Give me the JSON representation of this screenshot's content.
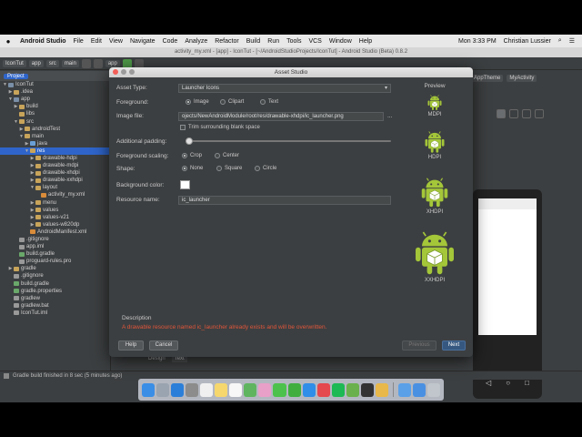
{
  "menubar": {
    "apple": "",
    "app_name": "Android Studio",
    "items": [
      "File",
      "Edit",
      "View",
      "Navigate",
      "Code",
      "Analyze",
      "Refactor",
      "Build",
      "Run",
      "Tools",
      "VCS",
      "Window",
      "Help"
    ],
    "clock": "Mon 3:33 PM",
    "user": "Christian Lussier"
  },
  "ide": {
    "window_title": "activity_my.xml - [app] - IconTut - [~/AndroidStudioProjects/IconTut] - Android Studio (Beta) 0.8.2",
    "breadcrumbs": [
      "IconTut",
      "app",
      "src",
      "main"
    ],
    "run_config": "app",
    "editor_chips": [
      "AppTheme",
      "MyActivity"
    ],
    "bottom_tabs": [
      "Design",
      "Text"
    ],
    "status_text": "Gradle build finished in 8 sec (5 minutes ago)"
  },
  "project": {
    "panel_tab": "Project",
    "tree": [
      {
        "label": "IconTut",
        "depth": 0,
        "twisty": "▼",
        "color": "#7a8fa8"
      },
      {
        "label": ".idea",
        "depth": 1,
        "twisty": "▶",
        "color": "#c8a45a"
      },
      {
        "label": "app",
        "depth": 1,
        "twisty": "▼",
        "color": "#7a8fa8"
      },
      {
        "label": "build",
        "depth": 2,
        "twisty": "▶",
        "color": "#c8a45a"
      },
      {
        "label": "libs",
        "depth": 2,
        "twisty": "",
        "color": "#c8a45a"
      },
      {
        "label": "src",
        "depth": 2,
        "twisty": "▼",
        "color": "#c8a45a"
      },
      {
        "label": "androidTest",
        "depth": 3,
        "twisty": "▶",
        "color": "#c8a45a"
      },
      {
        "label": "main",
        "depth": 3,
        "twisty": "▼",
        "color": "#c8a45a"
      },
      {
        "label": "java",
        "depth": 4,
        "twisty": "▶",
        "color": "#6a9fd6"
      },
      {
        "label": "res",
        "depth": 4,
        "twisty": "▼",
        "color": "#c8a45a",
        "selected": true
      },
      {
        "label": "drawable-hdpi",
        "depth": 5,
        "twisty": "▶",
        "color": "#c8a45a"
      },
      {
        "label": "drawable-mdpi",
        "depth": 5,
        "twisty": "▶",
        "color": "#c8a45a"
      },
      {
        "label": "drawable-xhdpi",
        "depth": 5,
        "twisty": "▶",
        "color": "#c8a45a"
      },
      {
        "label": "drawable-xxhdpi",
        "depth": 5,
        "twisty": "▶",
        "color": "#c8a45a"
      },
      {
        "label": "layout",
        "depth": 5,
        "twisty": "▼",
        "color": "#c8a45a"
      },
      {
        "label": "activity_my.xml",
        "depth": 6,
        "twisty": "",
        "color": "#d98c3a"
      },
      {
        "label": "menu",
        "depth": 5,
        "twisty": "▶",
        "color": "#c8a45a"
      },
      {
        "label": "values",
        "depth": 5,
        "twisty": "▶",
        "color": "#c8a45a"
      },
      {
        "label": "values-v21",
        "depth": 5,
        "twisty": "▶",
        "color": "#c8a45a"
      },
      {
        "label": "values-w820dp",
        "depth": 5,
        "twisty": "▶",
        "color": "#c8a45a"
      },
      {
        "label": "AndroidManifest.xml",
        "depth": 4,
        "twisty": "",
        "color": "#d98c3a"
      },
      {
        "label": ".gitignore",
        "depth": 2,
        "twisty": "",
        "color": "#999999"
      },
      {
        "label": "app.iml",
        "depth": 2,
        "twisty": "",
        "color": "#999999"
      },
      {
        "label": "build.gradle",
        "depth": 2,
        "twisty": "",
        "color": "#6aa86a"
      },
      {
        "label": "proguard-rules.pro",
        "depth": 2,
        "twisty": "",
        "color": "#999999"
      },
      {
        "label": "gradle",
        "depth": 1,
        "twisty": "▶",
        "color": "#c8a45a"
      },
      {
        "label": ".gitignore",
        "depth": 1,
        "twisty": "",
        "color": "#999999"
      },
      {
        "label": "build.gradle",
        "depth": 1,
        "twisty": "",
        "color": "#6aa86a"
      },
      {
        "label": "gradle.properties",
        "depth": 1,
        "twisty": "",
        "color": "#6aa86a"
      },
      {
        "label": "gradlew",
        "depth": 1,
        "twisty": "",
        "color": "#999999"
      },
      {
        "label": "gradlew.bat",
        "depth": 1,
        "twisty": "",
        "color": "#999999"
      },
      {
        "label": "IconTut.iml",
        "depth": 1,
        "twisty": "",
        "color": "#999999"
      }
    ]
  },
  "dialog": {
    "title": "Asset Studio",
    "asset_type_label": "Asset Type:",
    "asset_type_value": "Launcher Icons",
    "foreground_label": "Foreground:",
    "foreground_options": [
      "Image",
      "Clipart",
      "Text"
    ],
    "foreground_selected": 0,
    "image_file_label": "Image file:",
    "image_file_value": "ojects/NewAndroidModule/root/res/drawable-xhdpi/ic_launcher.png",
    "image_file_browse": "...",
    "trim_label": "Trim surrounding blank space",
    "padding_label": "Additional padding:",
    "padding_percent": 0,
    "scaling_label": "Foreground scaling:",
    "scaling_options": [
      "Crop",
      "Center"
    ],
    "scaling_selected": 0,
    "shape_label": "Shape:",
    "shape_options": [
      "None",
      "Square",
      "Circle"
    ],
    "shape_selected": 0,
    "bg_color_label": "Background color:",
    "bg_color": "#ffffff",
    "resource_name_label": "Resource name:",
    "resource_name_value": "ic_launcher",
    "preview_title": "Preview",
    "previews": [
      "MDPI",
      "HDPI",
      "XHDPI",
      "XXHDPI"
    ],
    "description_title": "Description",
    "warning": "A drawable resource named ic_launcher already exists and will be overwritten.",
    "buttons": {
      "help": "Help",
      "cancel": "Cancel",
      "previous": "Previous",
      "next": "Next"
    }
  },
  "colors": {
    "android_green": "#a4c639",
    "warning": "#e0553a",
    "selection": "#2f65ca"
  },
  "dock_icons": [
    "finder",
    "launchpad",
    "safari",
    "system-preferences",
    "calendar",
    "notes",
    "reminders",
    "maps",
    "photos",
    "messages",
    "facetime",
    "app-store",
    "music",
    "spotify",
    "android-studio",
    "terminal",
    "chrome",
    "documents",
    "downloads",
    "trash"
  ]
}
